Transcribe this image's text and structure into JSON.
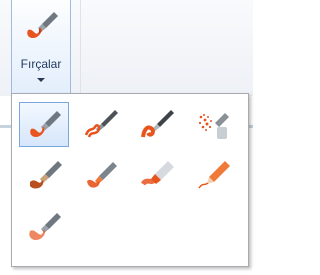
{
  "ribbon": {
    "brushes_button": {
      "label": "Fırçalar",
      "icon": "brush-icon",
      "dropdown_icon": "chevron-down-icon"
    }
  },
  "brushes_menu": {
    "items": [
      {
        "icon": "brush-icon",
        "selected": true
      },
      {
        "icon": "calligraphy-pen-icon",
        "selected": false
      },
      {
        "icon": "calligraphy-pen-2-icon",
        "selected": false
      },
      {
        "icon": "airbrush-icon",
        "selected": false
      },
      {
        "icon": "oil-brush-icon",
        "selected": false
      },
      {
        "icon": "crayon-icon",
        "selected": false
      },
      {
        "icon": "marker-icon",
        "selected": false
      },
      {
        "icon": "natural-pencil-icon",
        "selected": false
      },
      {
        "icon": "watercolor-brush-icon",
        "selected": false
      }
    ]
  },
  "colors": {
    "accent_orange": "#e8541e",
    "selection_border": "#7aa7dd"
  }
}
